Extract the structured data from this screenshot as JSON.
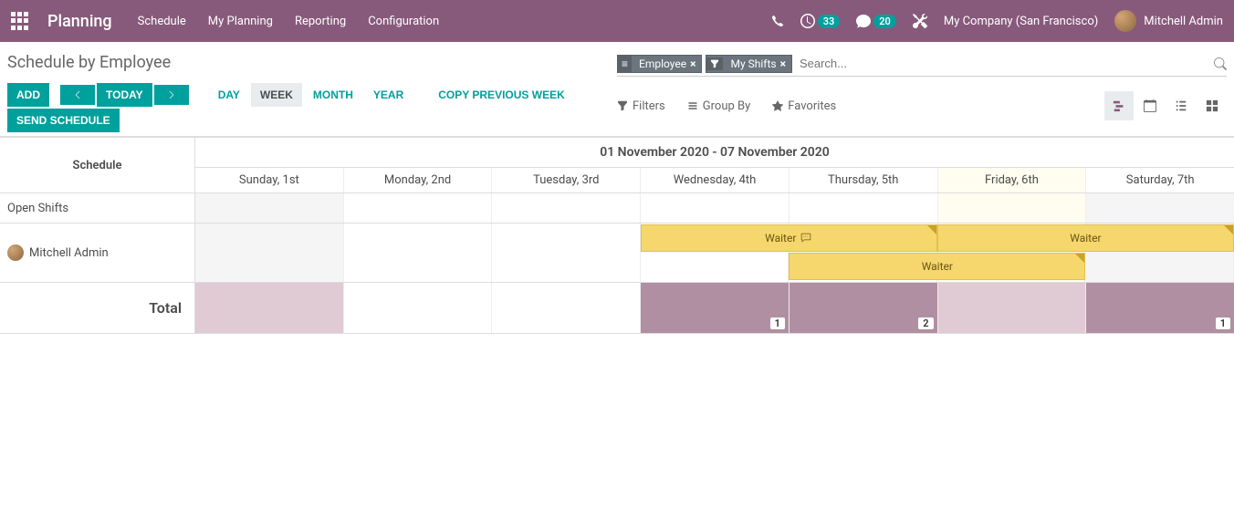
{
  "nav": {
    "brand": "Planning",
    "menu": [
      "Schedule",
      "My Planning",
      "Reporting",
      "Configuration"
    ],
    "badge_clock": "33",
    "badge_chat": "20",
    "company": "My Company (San Francisco)",
    "username": "Mitchell Admin"
  },
  "page": {
    "title": "Schedule by Employee",
    "add": "ADD",
    "today": "TODAY",
    "send": "SEND SCHEDULE",
    "views": {
      "day": "DAY",
      "week": "WEEK",
      "month": "MONTH",
      "year": "YEAR"
    },
    "copy_prev": "COPY PREVIOUS WEEK"
  },
  "search": {
    "chip1": "Employee",
    "chip2": "My Shifts",
    "placeholder": "Search...",
    "filters": "Filters",
    "groupby": "Group By",
    "favorites": "Favorites"
  },
  "grid": {
    "schedule_label": "Schedule",
    "date_range": "01 November 2020 - 07 November 2020",
    "days": [
      "Sunday, 1st",
      "Monday, 2nd",
      "Tuesday, 3rd",
      "Wednesday, 4th",
      "Thursday, 5th",
      "Friday, 6th",
      "Saturday, 7th"
    ],
    "today_index": 5,
    "rows": {
      "open": "Open Shifts",
      "employee": "Mitchell Admin",
      "total": "Total"
    },
    "shifts": {
      "s1": "Waiter",
      "s2": "Waiter",
      "s3": "Waiter"
    },
    "totals": {
      "wed": "1",
      "thu": "2",
      "sat": "1"
    }
  }
}
